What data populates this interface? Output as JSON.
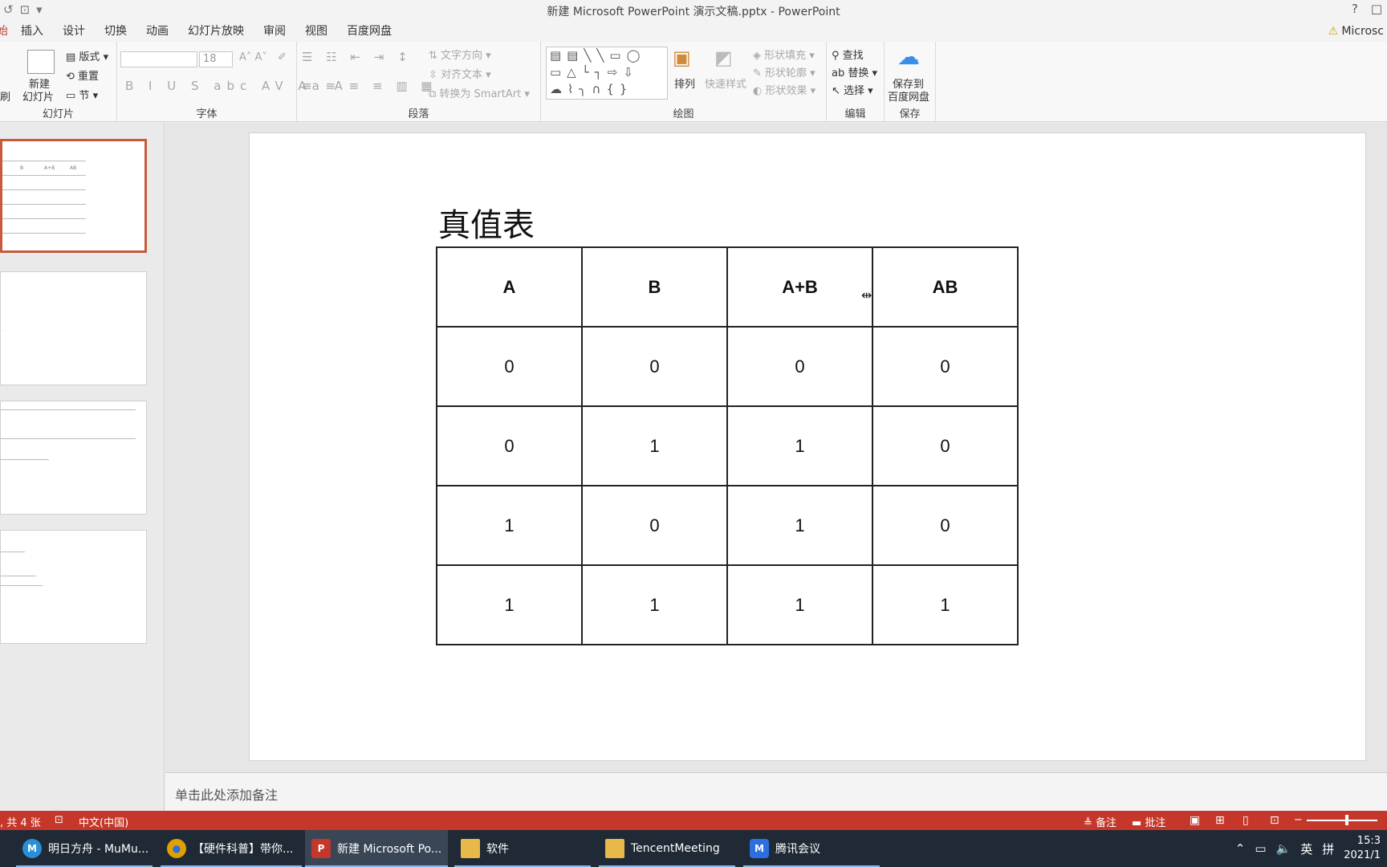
{
  "window": {
    "title": "新建 Microsoft PowerPoint 演示文稿.pptx - PowerPoint",
    "help": "?",
    "restore": "□"
  },
  "tabs": [
    "始",
    "插入",
    "设计",
    "切换",
    "动画",
    "幻灯片放映",
    "审阅",
    "视图",
    "百度网盘"
  ],
  "account": "Microsc",
  "ribbon": {
    "slides": {
      "new_slide": "新建",
      "new_slide2": "幻灯片",
      "layout": "版式",
      "reset": "重置",
      "section": "节",
      "label": "幻灯片",
      "brush": "刷"
    },
    "font": {
      "size": "18",
      "label": "字体"
    },
    "paragraph": {
      "text_direction": "文字方向",
      "align_text": "对齐文本",
      "smartart": "转换为 SmartArt",
      "label": "段落"
    },
    "drawing": {
      "arrange": "排列",
      "quick_styles": "快速样式",
      "shape_fill": "形状填充",
      "shape_outline": "形状轮廓",
      "shape_effects": "形状效果",
      "label": "绘图"
    },
    "editing": {
      "find": "查找",
      "replace": "替换",
      "select": "选择",
      "label": "编辑"
    },
    "save": {
      "line1": "保存到",
      "line2": "百度网盘",
      "label": "保存"
    }
  },
  "slide": {
    "title": "真值表",
    "headers": [
      "A",
      "B",
      "A+B",
      "AB"
    ],
    "rows": [
      [
        "0",
        "0",
        "0",
        "0"
      ],
      [
        "0",
        "1",
        "1",
        "0"
      ],
      [
        "1",
        "0",
        "1",
        "0"
      ],
      [
        "1",
        "1",
        "1",
        "1"
      ]
    ]
  },
  "thumbnails": {
    "t1_headers": [
      "B",
      "A+B",
      "AB"
    ],
    "t1_vals": [
      "0",
      "0",
      "1",
      "0",
      "0",
      "1",
      "1",
      "1"
    ]
  },
  "notes_placeholder": "单击此处添加备注",
  "status": {
    "slide_count": ", 共 4 张",
    "language": "中文(中国)",
    "notes": "备注",
    "comments": "批注"
  },
  "taskbar": [
    {
      "label": "明日方舟 - MuMu...",
      "color": "#2a8fd8",
      "glyph": "M"
    },
    {
      "label": "【硬件科普】带你...",
      "color": "#e0a000",
      "glyph": "●"
    },
    {
      "label": "新建 Microsoft Po...",
      "color": "#c4372a",
      "glyph": "P"
    },
    {
      "label": "软件",
      "color": "#e8b84a",
      "glyph": "▮"
    },
    {
      "label": "TencentMeeting",
      "color": "#e8b84a",
      "glyph": "▮"
    },
    {
      "label": "腾讯会议",
      "color": "#2b6fe0",
      "glyph": "M"
    }
  ],
  "tray": {
    "ime": "英",
    "ime2": "拼",
    "time": "15:3",
    "date": "2021/1"
  }
}
